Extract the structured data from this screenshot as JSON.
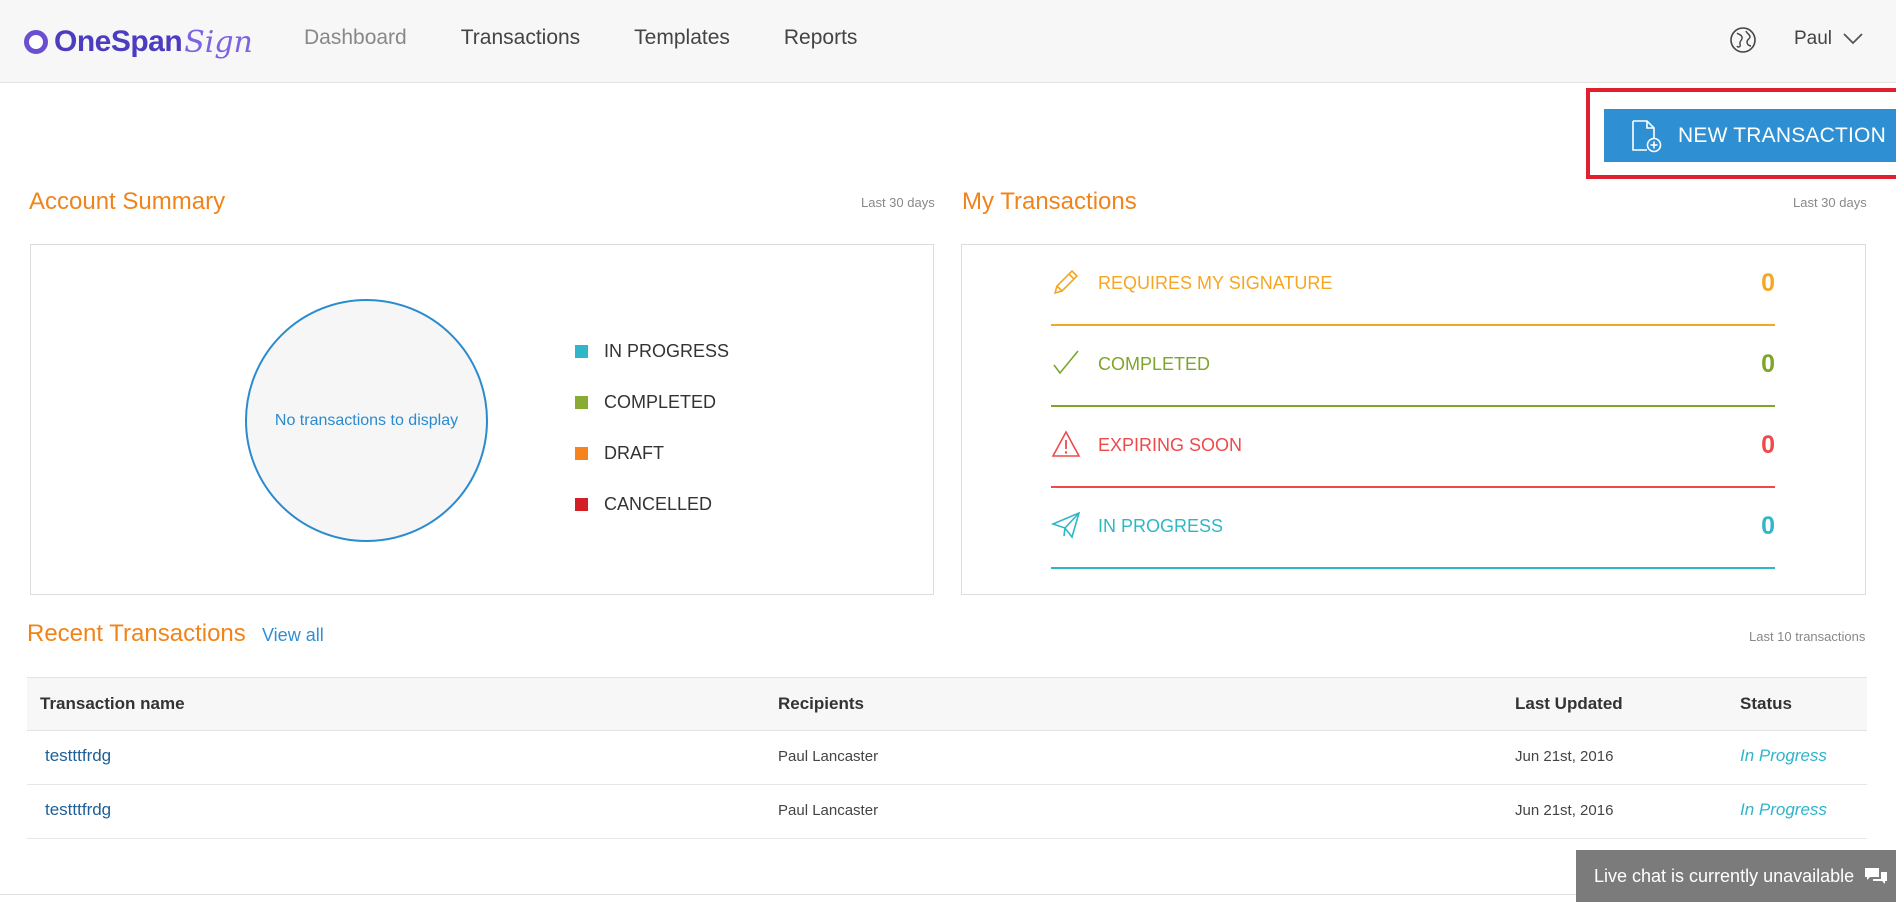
{
  "header": {
    "brand_primary": "OneSpan",
    "brand_secondary": "Sign",
    "nav": [
      {
        "label": "Dashboard",
        "active": true
      },
      {
        "label": "Transactions",
        "active": false
      },
      {
        "label": "Templates",
        "active": false
      },
      {
        "label": "Reports",
        "active": false
      }
    ],
    "globe_icon": "globe-icon",
    "user_name": "Paul"
  },
  "actions": {
    "new_transaction_label": "NEW TRANSACTION",
    "new_transaction_icon": "document-add-icon"
  },
  "account_summary": {
    "title": "Account Summary",
    "period": "Last 30 days",
    "empty_text": "No transactions to display",
    "legend": [
      {
        "label": "IN PROGRESS",
        "color": "#2fb7c8"
      },
      {
        "label": "COMPLETED",
        "color": "#8aab33"
      },
      {
        "label": "DRAFT",
        "color": "#f5841f"
      },
      {
        "label": "CANCELLED",
        "color": "#d32027"
      }
    ]
  },
  "my_transactions": {
    "title": "My Transactions",
    "period": "Last 30 days",
    "rows": [
      {
        "label": "REQUIRES MY SIGNATURE",
        "count": "0",
        "color": "#f5a623",
        "icon": "pencil-icon"
      },
      {
        "label": "COMPLETED",
        "count": "0",
        "color": "#7ea52a",
        "icon": "checkmark-icon"
      },
      {
        "label": "EXPIRING SOON",
        "count": "0",
        "color": "#ef4a4a",
        "icon": "warning-icon"
      },
      {
        "label": "IN PROGRESS",
        "count": "0",
        "color": "#2fb7c8",
        "icon": "paper-plane-icon"
      }
    ]
  },
  "recent": {
    "title": "Recent Transactions",
    "view_all": "View all",
    "note": "Last 10 transactions",
    "columns": [
      "Transaction name",
      "Recipients",
      "Last Updated",
      "Status"
    ],
    "rows": [
      {
        "name": "testttfrdg",
        "recipients": "Paul Lancaster",
        "updated": "Jun 21st, 2016",
        "status": "In Progress"
      },
      {
        "name": "testttfrdg",
        "recipients": "Paul Lancaster",
        "updated": "Jun 21st, 2016",
        "status": "In Progress"
      }
    ]
  },
  "chat": {
    "label": "Live chat is currently unavailable",
    "icon": "chat-bubbles-icon"
  },
  "colors": {
    "accent_orange": "#f0841a",
    "primary_blue": "#2e90d3",
    "highlight_red": "#e0202c"
  }
}
